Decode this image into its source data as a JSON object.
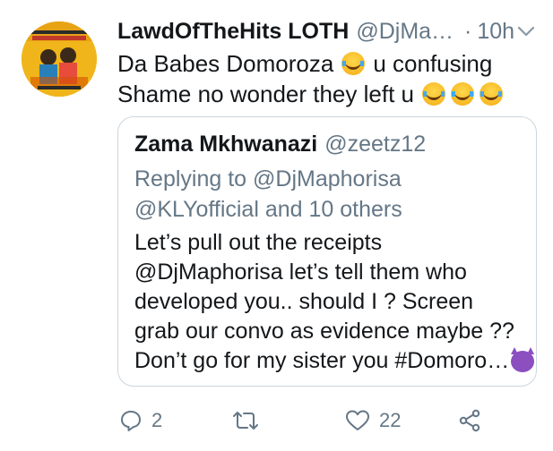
{
  "tweet": {
    "display_name": "LawdOfTheHits LOTH",
    "handle": "@DjMa…",
    "separator": "·",
    "time": "10h",
    "text_line1": "Da Babes Domoroza",
    "text_line1_after": "u confusing",
    "text_line2": "Shame no wonder they left u"
  },
  "quote": {
    "display_name": "Zama Mkhwanazi",
    "handle": "@zeetz12",
    "reply_line1": "Replying to @DjMaphorisa",
    "reply_line2": "@KLYofficial and 10 others",
    "text_lines": [
      "Let’s pull out the receipts",
      "@DjMaphorisa let’s tell them who",
      "developed you.. should I ? Screen",
      "grab our convo as evidence maybe ??",
      "Don’t go for my sister you #Domoro…"
    ]
  },
  "actions": {
    "reply_count": "2",
    "retweet_count": "",
    "like_count": "22"
  },
  "icons": {
    "reply": "comment-icon",
    "retweet": "retweet-icon",
    "like": "heart-icon",
    "share": "share-icon",
    "caret": "chevron-down-icon",
    "emoji_laugh": "tears-of-joy-icon",
    "emoji_devil": "smiling-devil-icon"
  },
  "colors": {
    "text": "#14171a",
    "secondary": "#657786",
    "border": "#ccd6dd",
    "avatar_bg": "#f0b51a"
  }
}
